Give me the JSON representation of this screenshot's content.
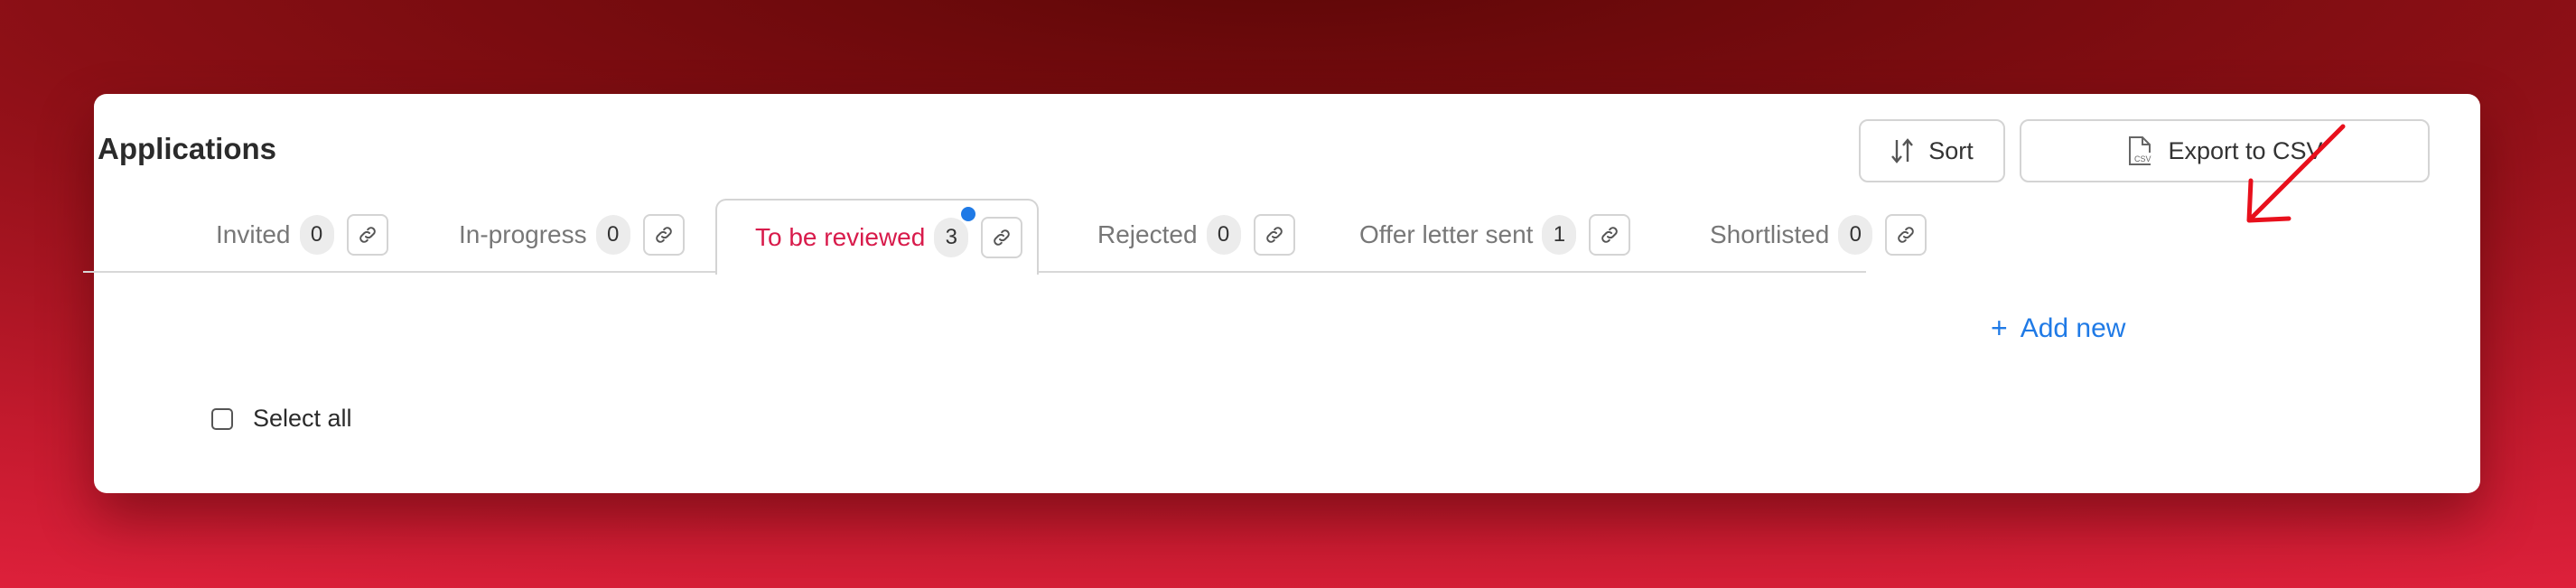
{
  "page": {
    "title": "Applications"
  },
  "toolbar": {
    "sort_label": "Sort",
    "export_label": "Export to CSV",
    "sort_icon": "sort-icon",
    "export_icon": "csv-file-icon",
    "csv_badge": "CSV"
  },
  "tabs": [
    {
      "label": "Invited",
      "count": "0",
      "active": false
    },
    {
      "label": "In-progress",
      "count": "0",
      "active": false
    },
    {
      "label": "To be reviewed",
      "count": "3",
      "active": true,
      "has_notification": true
    },
    {
      "label": "Rejected",
      "count": "0",
      "active": false
    },
    {
      "label": "Offer letter sent",
      "count": "1",
      "active": false
    },
    {
      "label": "Shortlisted",
      "count": "0",
      "active": false
    }
  ],
  "add_new": {
    "plus": "+",
    "label": "Add new"
  },
  "selection": {
    "select_all_label": "Select all",
    "checked": false
  },
  "colors": {
    "active_tab_text": "#d81b4b",
    "accent_blue": "#1f7ae6",
    "annotation_arrow": "#e8101c",
    "background_dark": "#5e0707",
    "background_bright": "#ee2443"
  }
}
